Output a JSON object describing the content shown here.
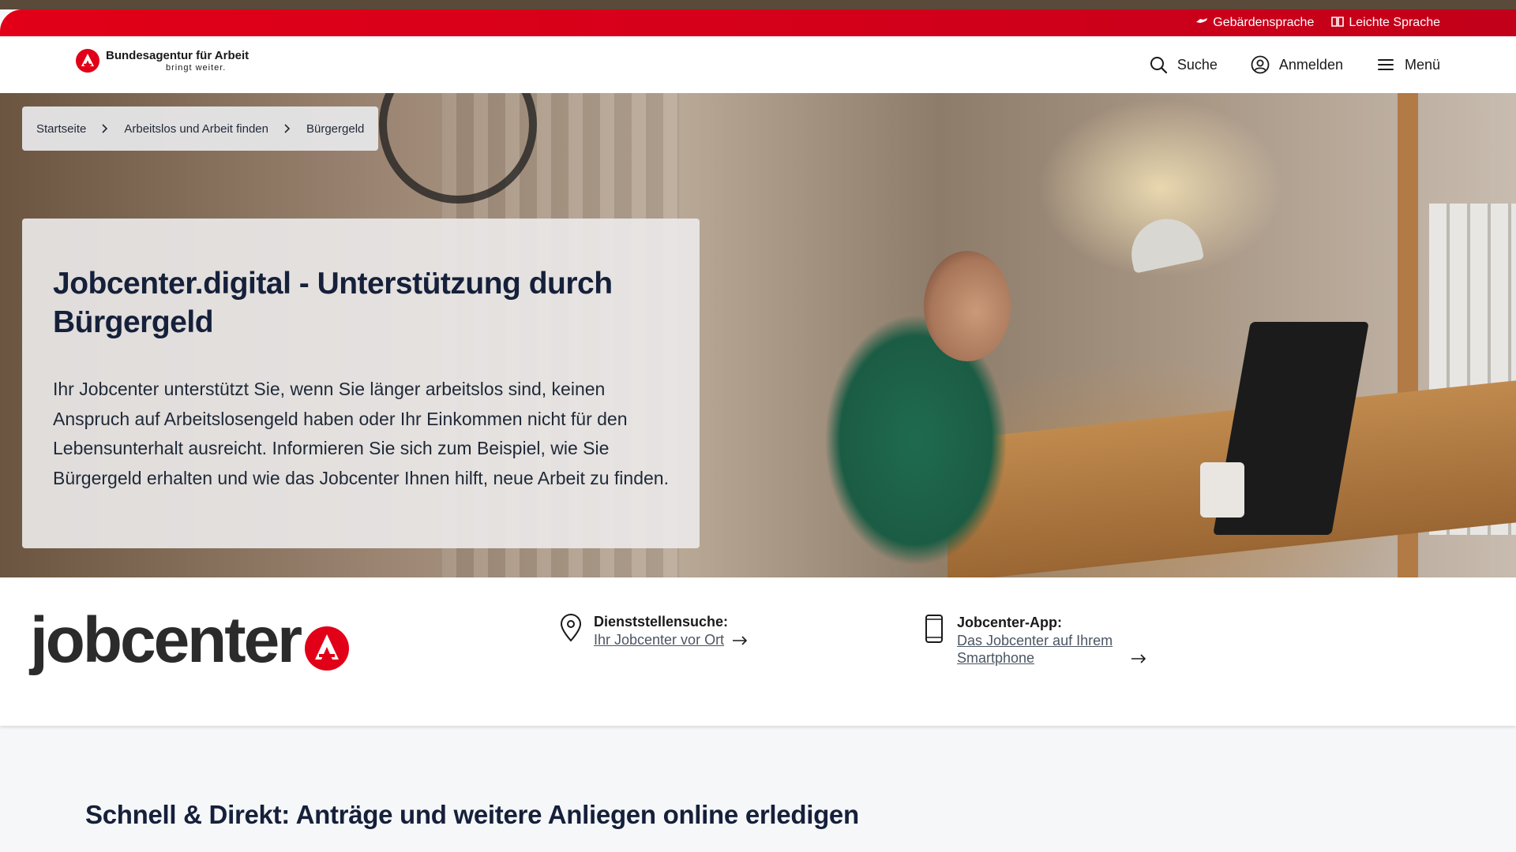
{
  "utility": {
    "sign_language": "Gebärdensprache",
    "easy_language": "Leichte Sprache"
  },
  "header": {
    "logo_title": "Bundesagentur für Arbeit",
    "logo_claim": "bringt weiter.",
    "search": "Suche",
    "login": "Anmelden",
    "menu": "Menü"
  },
  "breadcrumb": {
    "items": [
      "Startseite",
      "Arbeitslos und Arbeit finden",
      "Bürgergeld"
    ]
  },
  "hero": {
    "title": "Jobcenter.digital - Unterstützung durch Bürgergeld",
    "text": "Ihr Jobcenter unterstützt Sie, wenn Sie länger arbeitslos sind, keinen Anspruch auf Arbeitslosengeld haben oder Ihr Einkommen nicht für den Lebensunterhalt ausreicht. Informieren Sie sich zum Beispiel, wie Sie Bürgergeld erhalten und wie das Jobcenter Ihnen hilft, neue Arbeit zu finden."
  },
  "jobcenter": {
    "logo_text": "jobcenter",
    "services": [
      {
        "title": "Dienststellensuche:",
        "link": "Ihr Jobcenter vor Ort",
        "icon": "location-pin-icon"
      },
      {
        "title": "Jobcenter-App:",
        "link": "Das Jobcenter auf Ihrem Smartphone",
        "icon": "smartphone-icon"
      }
    ]
  },
  "section": {
    "title": "Schnell & Direkt: Anträge und weitere Anliegen online erledigen"
  },
  "colors": {
    "brand_red": "#e10018",
    "dark_text": "#15203a"
  }
}
